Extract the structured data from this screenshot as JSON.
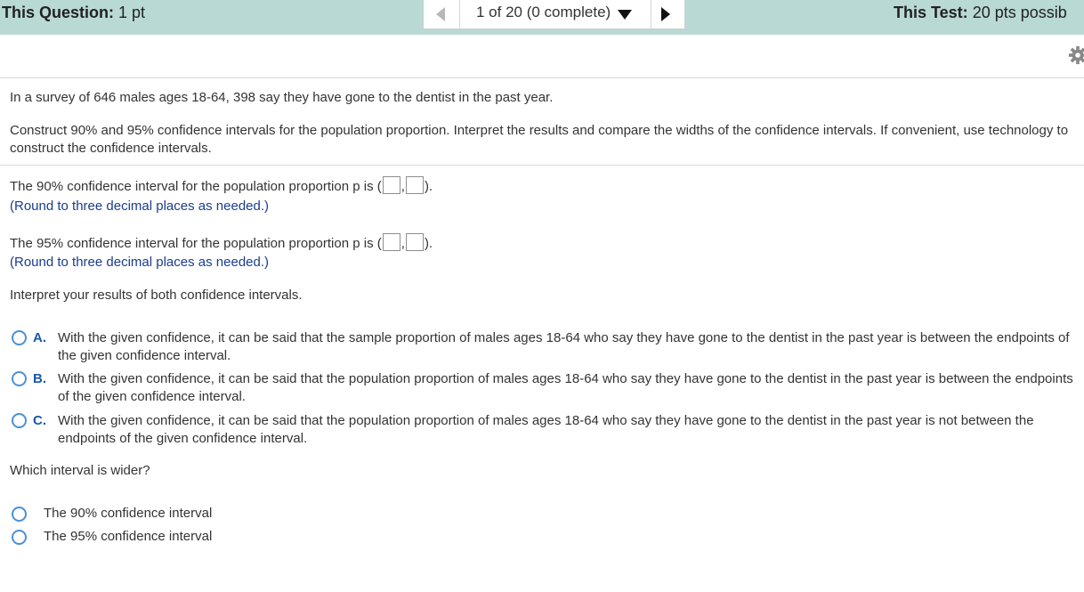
{
  "header": {
    "question_label": "This Question:",
    "question_value": "1 pt",
    "nav_text": "1 of 20 (0 complete)",
    "test_label": "This Test:",
    "test_value": "20 pts possib"
  },
  "problem": {
    "intro": "In a survey of 646 males ages 18-64, 398 say they have gone to the dentist in the past year.",
    "instructions": "Construct 90% and 95% confidence intervals for the population proportion. Interpret the results and compare the widths of the confidence intervals. If convenient, use technology to construct the confidence intervals."
  },
  "part_90": {
    "prefix": "The 90% confidence interval for the population proportion p is (",
    "separator": ",",
    "suffix": ").",
    "hint": "(Round to three decimal places as needed.)",
    "lower_value": "",
    "upper_value": ""
  },
  "part_95": {
    "prefix": "The 95% confidence interval for the population proportion p is (",
    "separator": ",",
    "suffix": ").",
    "hint": "(Round to three decimal places as needed.)",
    "lower_value": "",
    "upper_value": ""
  },
  "interpret": {
    "prompt": "Interpret your results of both confidence intervals.",
    "options": [
      {
        "letter": "A.",
        "text": "With the given confidence, it can be said that the sample proportion of males ages 18-64 who say they have gone to the dentist in the past year is between the endpoints of the given confidence interval."
      },
      {
        "letter": "B.",
        "text": "With the given confidence, it can be said that the population proportion of males ages 18-64 who say they have gone to the dentist in the past year is between the endpoints of the given confidence interval."
      },
      {
        "letter": "C.",
        "text": "With the given confidence, it can be said that the population proportion of males ages 18-64 who say they have gone to the dentist in the past year is not between the endpoints of the given confidence interval."
      }
    ]
  },
  "wider": {
    "prompt": "Which interval is wider?",
    "options": [
      "The 90% confidence interval",
      "The 95% confidence interval"
    ]
  },
  "colors": {
    "header_bg": "#b9d9d4",
    "hint_text": "#1a3d8f",
    "radio_border": "#4a90d9",
    "option_letter": "#1a56a8"
  },
  "icons": [
    "gear-icon",
    "prev-arrow-icon",
    "next-arrow-icon",
    "dropdown-caret-icon"
  ]
}
